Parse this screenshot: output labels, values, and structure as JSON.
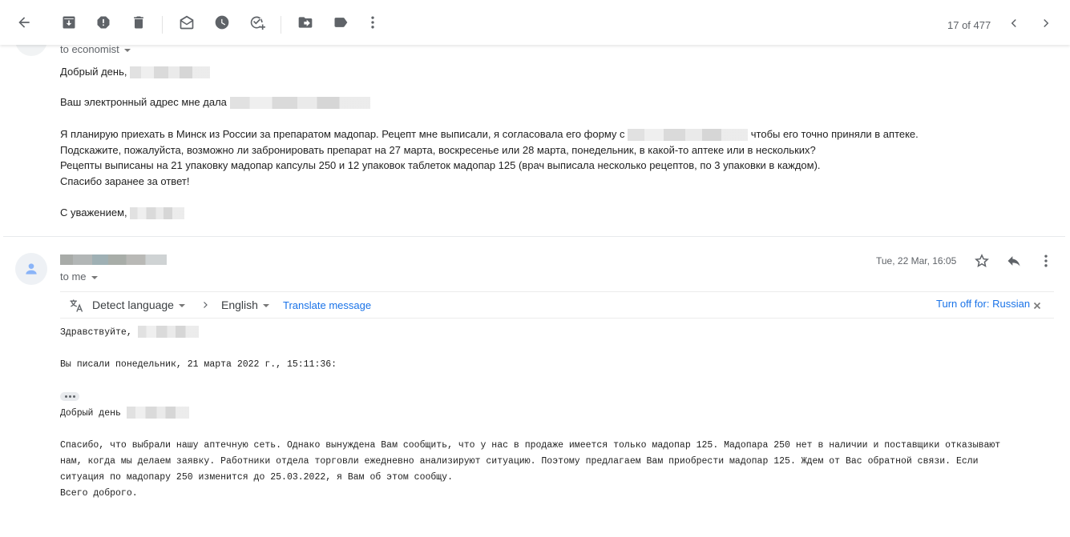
{
  "toolbar": {
    "back": "back-arrow",
    "actions": [
      "archive",
      "report-spam",
      "delete",
      "mark-unread",
      "snooze",
      "add-to-tasks",
      "move-to",
      "labels",
      "more"
    ],
    "pager": "17 of 477"
  },
  "message1": {
    "to_line": "to economist",
    "greeting": "Добрый день,",
    "line_address": "Ваш электронный адрес мне дала",
    "para1_a": "Я планирую приехать в Минск из России за препаратом мадопар. Рецепт мне выписали, я согласовала его форму с",
    "para1_b": "чтобы его точно приняли в аптеке.",
    "para2": "Подскажите, пожалуйста, возможно ли забронировать препарат на 27 марта, воскресенье или 28 марта, понедельник, в какой-то аптеке или в нескольких?",
    "para3": "Рецепты выписаны на 21 упаковку мадопар капсулы 250 и 12 упаковок таблеток мадопар 125 (врач выписала несколько рецептов, по 3 упаковки в каждом).",
    "para4": "Спасибо заранее за ответ!",
    "signoff": "С уважением,"
  },
  "message2": {
    "to_line": "to me",
    "date": "Tue, 22 Mar, 16:05",
    "translate": {
      "source": "Detect language",
      "target": "English",
      "action": "Translate message",
      "turn_off": "Turn off for: Russian"
    },
    "greeting": "Здравствуйте,",
    "quote_header": "Вы писали понедельник, 21 марта 2022 г., 15:11:36:",
    "quoted_greeting": "Добрый день",
    "body_line1": "Спасибо, что выбрали нашу аптечную сеть. Однако вынуждена Вам сообщить, что у нас в продаже имеется только мадопар 125. Мадопара 250 нет в наличии и поставщики отказывают",
    "body_line2": "нам, когда мы делаем заявку. Работники отдела торговли ежедневно анализируют ситуацию. Поэтому предлагаем Вам приобрести мадопар 125. Ждем от Вас обратной связи. Если",
    "body_line3": "ситуация по мадопару 250 изменится до 25.03.2022, я Вам об этом сообщу.",
    "body_line4": "Всего доброго."
  },
  "colors": {
    "link": "#1a73e8",
    "icon": "#5f6368",
    "avatar_icon": "#8ab4f8"
  }
}
